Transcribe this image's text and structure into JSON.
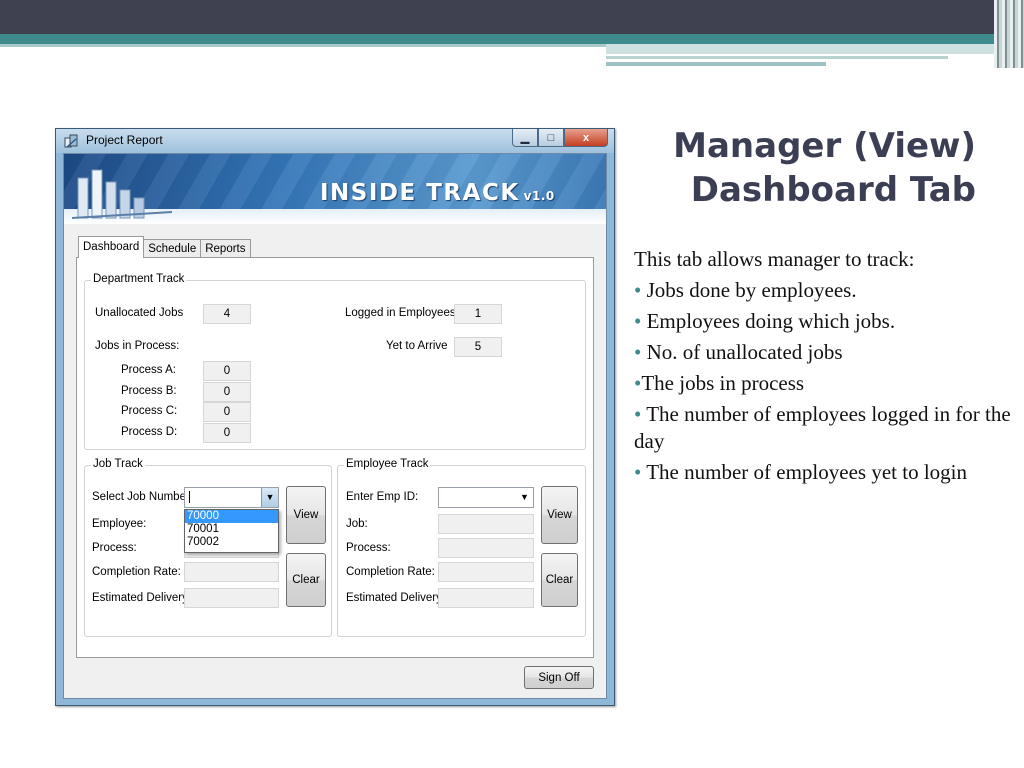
{
  "slide": {
    "title_line1": "Manager (View)",
    "title_line2": "Dashboard Tab",
    "intro": "This tab allows manager to track:",
    "bullets": [
      " Jobs done by employees.",
      " Employees doing which jobs.",
      " No. of unallocated jobs",
      "The jobs in process",
      " The number of employees logged in for the day",
      " The number of employees yet to login"
    ],
    "bullet_char": "•"
  },
  "window": {
    "title": "Project Report",
    "controls": {
      "minimize": "▁",
      "maximize": "□",
      "close": "x"
    },
    "banner": {
      "text": "INSIDE TRACK",
      "version": "v1.0"
    },
    "tabs": [
      "Dashboard",
      "Schedule",
      "Reports"
    ],
    "active_tab": "Dashboard",
    "department_track": {
      "label": "Department Track",
      "unallocated_jobs_label": "Unallocated Jobs",
      "unallocated_jobs": "4",
      "logged_in_label": "Logged in Employees",
      "logged_in": "1",
      "yet_to_arrive_label": "Yet to Arrive",
      "yet_to_arrive": "5",
      "jobs_in_process_label": "Jobs in Process:",
      "processes": [
        {
          "label": "Process A:",
          "value": "0"
        },
        {
          "label": "Process B:",
          "value": "0"
        },
        {
          "label": "Process C:",
          "value": "0"
        },
        {
          "label": "Process D:",
          "value": "0"
        }
      ]
    },
    "job_track": {
      "label": "Job Track",
      "select_label": "Select Job Number",
      "select_value": "",
      "options": [
        "70000",
        "70001",
        "70002"
      ],
      "employee_label": "Employee:",
      "process_label": "Process:",
      "completion_label": "Completion Rate:",
      "delivery_label": "Estimated Delivery:",
      "view_label": "View",
      "clear_label": "Clear"
    },
    "employee_track": {
      "label": "Employee Track",
      "emp_id_label": "Enter Emp ID:",
      "emp_id_value": "",
      "job_label": "Job:",
      "process_label": "Process:",
      "completion_label": "Completion Rate:",
      "delivery_label": "Estimated Delivery:",
      "view_label": "View",
      "clear_label": "Clear"
    },
    "sign_off_label": "Sign Off"
  }
}
